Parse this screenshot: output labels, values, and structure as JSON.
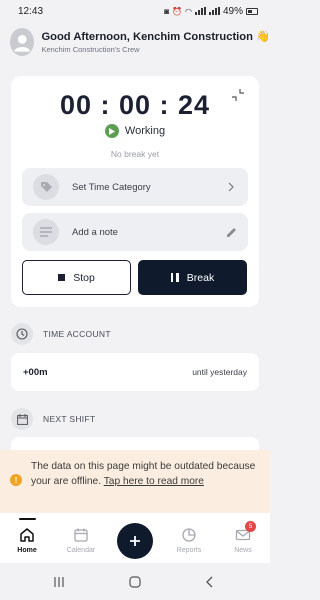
{
  "status_bar": {
    "time": "12:43",
    "battery": "49%"
  },
  "header": {
    "greeting": "Good Afternoon, Kenchim Construction 👋",
    "crew": "Kenchim Construction's Crew"
  },
  "timer": {
    "value": "00 : 00 : 24",
    "status": "Working",
    "break_info": "No break yet"
  },
  "options": {
    "time_category": "Set Time Category",
    "note_placeholder": "Add a note"
  },
  "buttons": {
    "stop": "Stop",
    "break": "Break"
  },
  "time_account": {
    "title": "TIME ACCOUNT",
    "value": "+00m",
    "note": "until yesterday"
  },
  "next_shift": {
    "title": "NEXT SHIFT"
  },
  "offline_banner": {
    "message": "The data on this page might be outdated because your are offline.",
    "link": "Tap here to read more"
  },
  "tabs": [
    {
      "label": "Home",
      "active": true
    },
    {
      "label": "Calendar",
      "active": false
    },
    {
      "label": "Reports",
      "active": false
    },
    {
      "label": "News",
      "active": false,
      "badge": "5"
    }
  ],
  "colors": {
    "primary": "#0f1b2d",
    "working": "#5e9e54",
    "warning": "#f0a325",
    "badge": "#e64545",
    "banner": "#fbeee0"
  }
}
